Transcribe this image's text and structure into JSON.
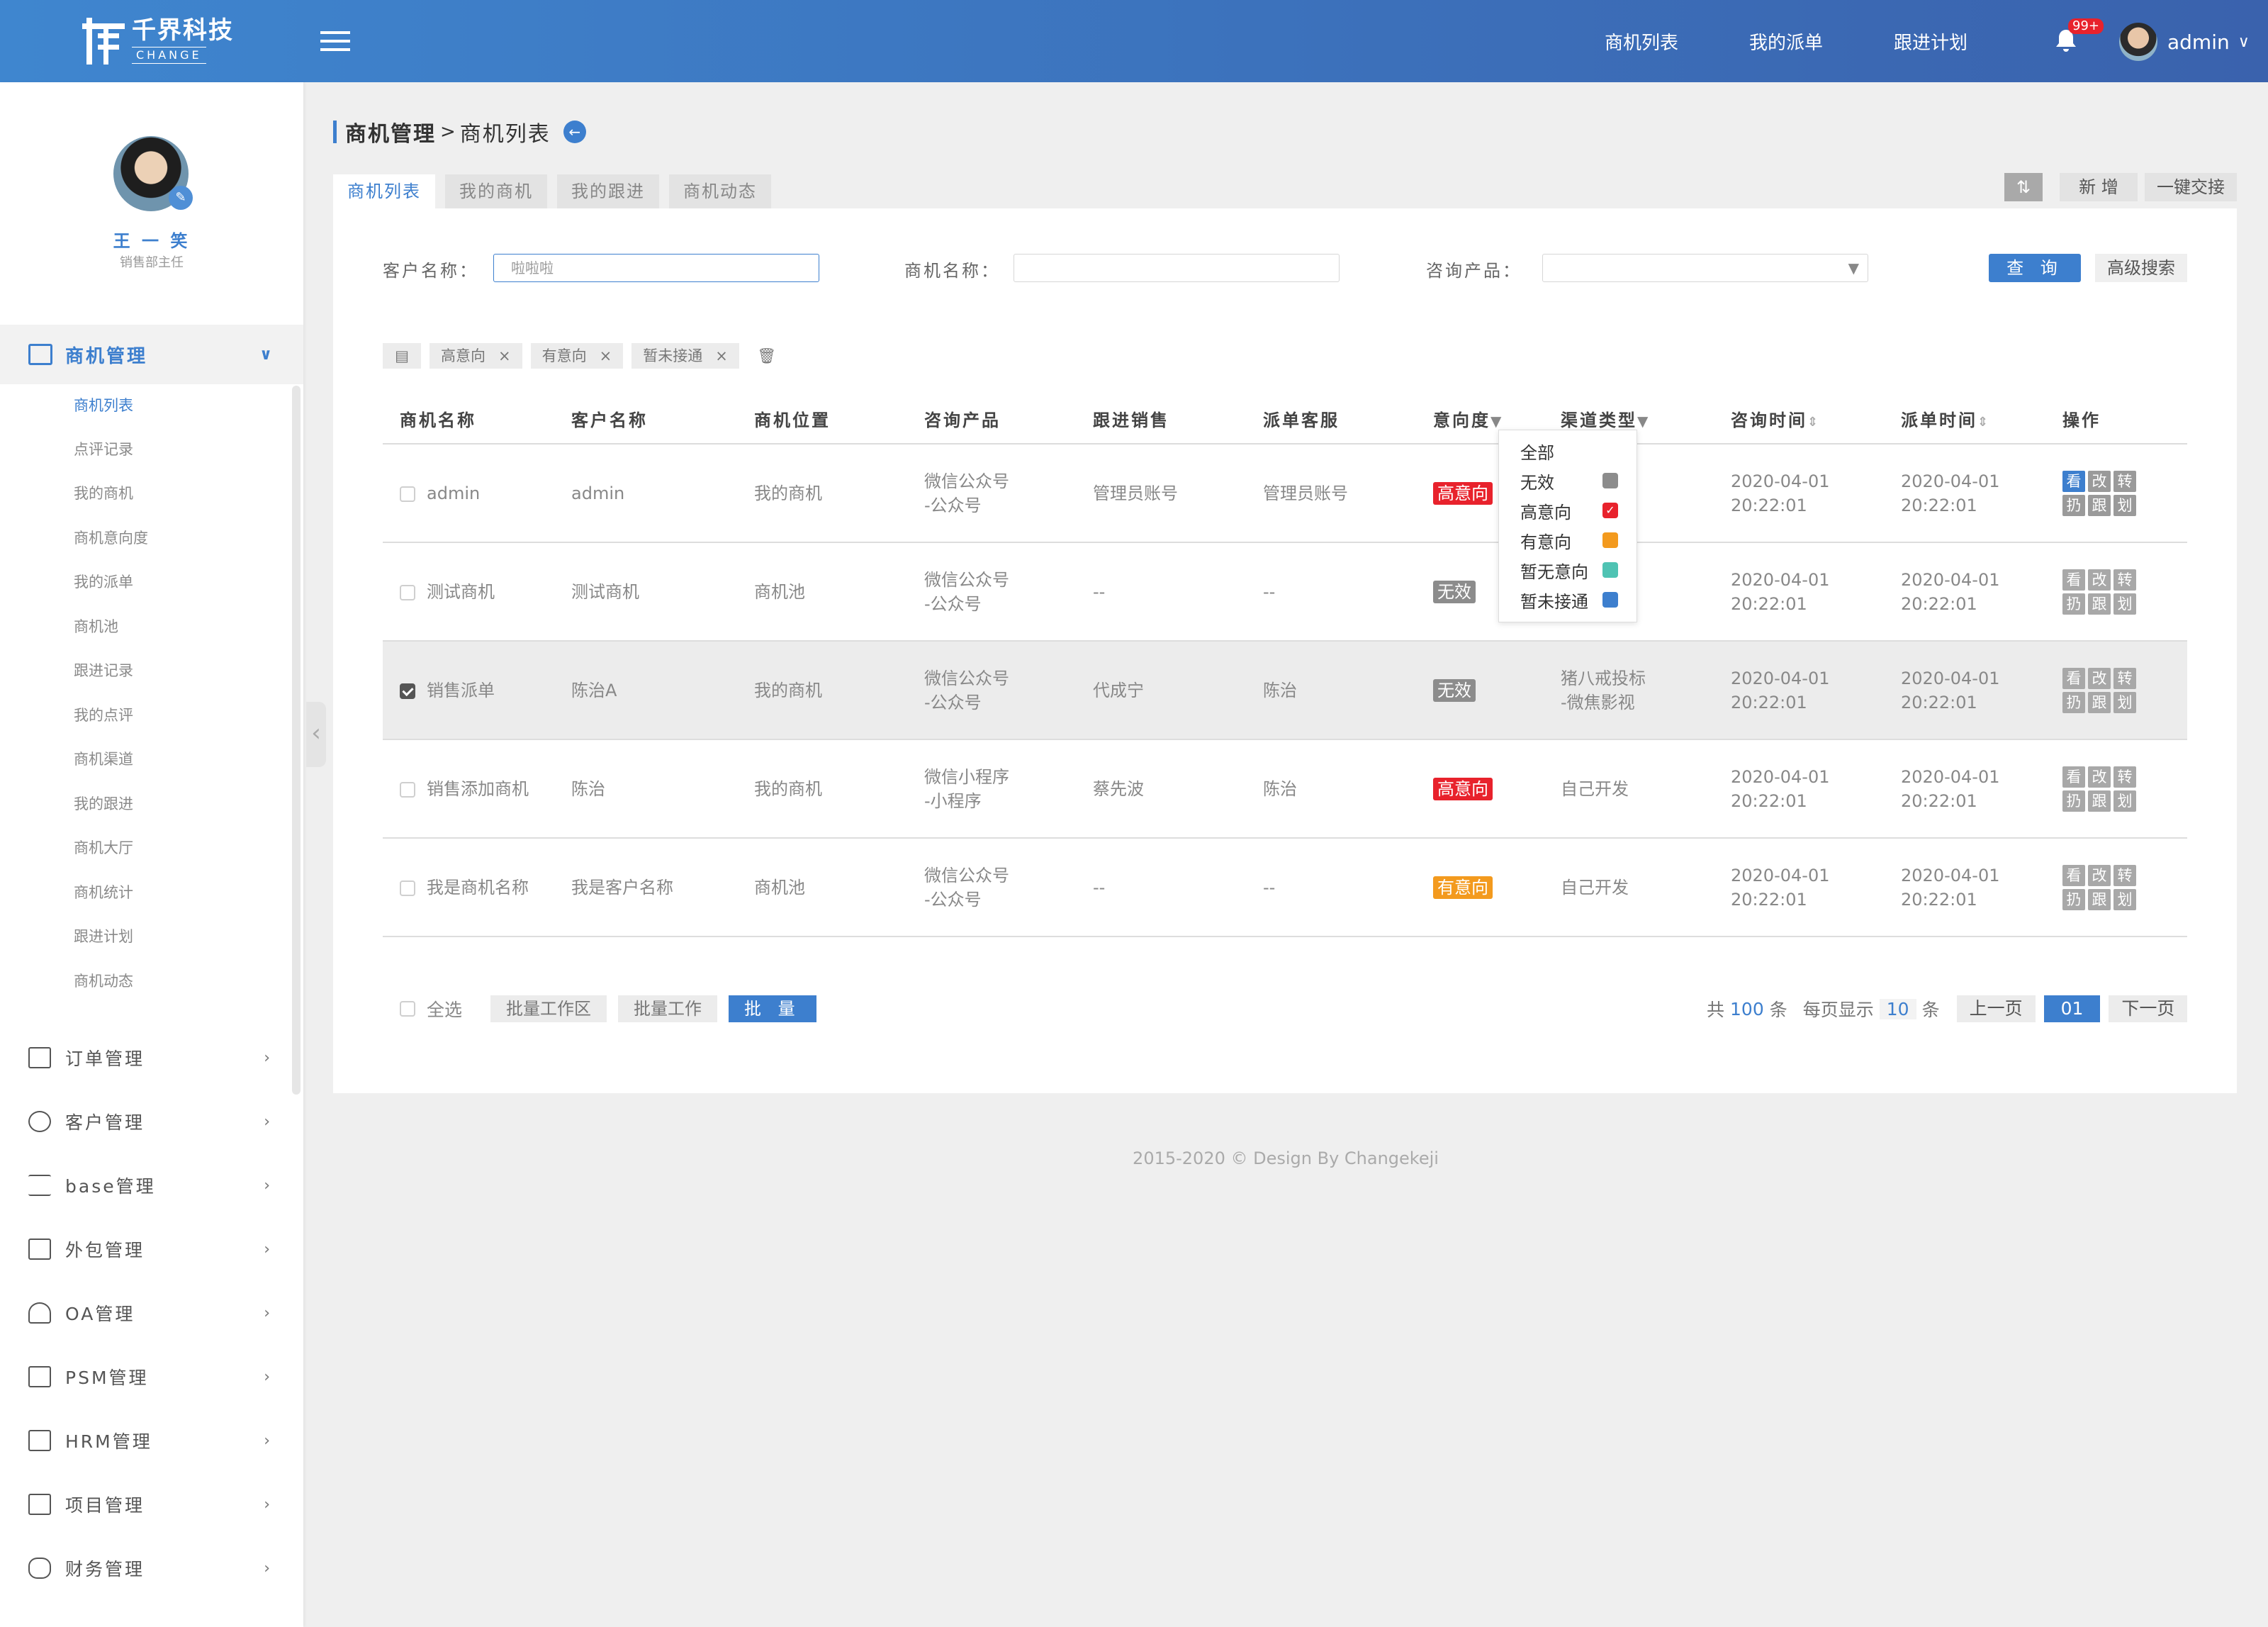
{
  "brand": {
    "name_cn": "千界科技",
    "name_en": "CHANGE"
  },
  "topnav": [
    "商机列表",
    "我的派单",
    "跟进计划"
  ],
  "notifications": {
    "count": "99+"
  },
  "user": {
    "name": "admin"
  },
  "profile": {
    "name": "王 一 笑",
    "role": "销售部主任"
  },
  "sidebar": {
    "active_section": "商机管理",
    "sub_items": [
      "商机列表",
      "点评记录",
      "我的商机",
      "商机意向度",
      "我的派单",
      "商机池",
      "跟进记录",
      "我的点评",
      "商机渠道",
      "我的跟进",
      "商机大厅",
      "商机统计",
      "跟进计划",
      "商机动态"
    ],
    "sections": [
      "订单管理",
      "客户管理",
      "base管理",
      "外包管理",
      "OA管理",
      "PSM管理",
      "HRM管理",
      "项目管理",
      "财务管理"
    ]
  },
  "breadcrumb": {
    "parent": "商机管理",
    "sep": ">",
    "current": "商机列表"
  },
  "tabs": [
    "商机列表",
    "我的商机",
    "我的跟进",
    "商机动态"
  ],
  "actions": {
    "new": "新 增",
    "handover": "一键交接"
  },
  "filters": {
    "customer_label": "客户名称：",
    "customer_value": "啦啦啦",
    "opportunity_label": "商机名称：",
    "product_label": "咨询产品：",
    "query": "查 询",
    "advanced": "高级搜索"
  },
  "chips": [
    "高意向",
    "有意向",
    "暂未接通"
  ],
  "table": {
    "headers": [
      "商机名称",
      "客户名称",
      "商机位置",
      "咨询产品",
      "跟进销售",
      "派单客服",
      "意向度",
      "渠道类型",
      "咨询时间",
      "派单时间",
      "操作"
    ],
    "rows": [
      {
        "name": "admin",
        "customer": "admin",
        "location": "我的商机",
        "product1": "微信公众号",
        "product2": "-公众号",
        "sales": "管理员账号",
        "service": "管理员账号",
        "intent": "高意向",
        "channel1": "",
        "channel2": "",
        "t1a": "2020-04-01",
        "t1b": "20:22:01",
        "t2a": "2020-04-01",
        "t2b": "20:22:01",
        "checked": false
      },
      {
        "name": "测试商机",
        "customer": "测试商机",
        "location": "商机池",
        "product1": "微信公众号",
        "product2": "-公众号",
        "sales": "--",
        "service": "--",
        "intent": "无效",
        "channel1": "",
        "channel2": "",
        "t1a": "2020-04-01",
        "t1b": "20:22:01",
        "t2a": "2020-04-01",
        "t2b": "20:22:01",
        "checked": false
      },
      {
        "name": "销售派单",
        "customer": "陈治A",
        "location": "我的商机",
        "product1": "微信公众号",
        "product2": "-公众号",
        "sales": "代成宁",
        "service": "陈治",
        "intent": "无效",
        "channel1": "猪八戒投标",
        "channel2": "-微焦影视",
        "t1a": "2020-04-01",
        "t1b": "20:22:01",
        "t2a": "2020-04-01",
        "t2b": "20:22:01",
        "checked": true
      },
      {
        "name": "销售添加商机",
        "customer": "陈治",
        "location": "我的商机",
        "product1": "微信小程序",
        "product2": "-小程序",
        "sales": "蔡先波",
        "service": "陈治",
        "intent": "高意向",
        "channel1": "自己开发",
        "channel2": "",
        "t1a": "2020-04-01",
        "t1b": "20:22:01",
        "t2a": "2020-04-01",
        "t2b": "20:22:01",
        "checked": false
      },
      {
        "name": "我是商机名称",
        "customer": "我是客户名称",
        "location": "商机池",
        "product1": "微信公众号",
        "product2": "-公众号",
        "sales": "--",
        "service": "--",
        "intent": "有意向",
        "channel1": "自己开发",
        "channel2": "",
        "t1a": "2020-04-01",
        "t1b": "20:22:01",
        "t2a": "2020-04-01",
        "t2b": "20:22:01",
        "checked": false
      }
    ],
    "ops": [
      "看",
      "改",
      "转",
      "扔",
      "跟",
      "划"
    ]
  },
  "intent_dropdown": [
    "全部",
    "无效",
    "高意向",
    "有意向",
    "暂无意向",
    "暂未接通"
  ],
  "colors": {
    "无效": "#8c8c8c",
    "高意向": "#e8222c",
    "有意向": "#f39a1e",
    "暂无意向": "#4fc3b3",
    "暂未接通": "#3d7fce",
    "accent": "#3d7fce"
  },
  "bottom": {
    "select_all": "全选",
    "batch_area": "批量工作区",
    "batch_work": "批量工作",
    "batch": "批 量"
  },
  "pagination": {
    "total_prefix": "共",
    "total": "100",
    "total_suffix": "条",
    "per_page_prefix": "每页显示",
    "per_page": "10",
    "per_page_suffix": "条",
    "prev": "上一页",
    "current": "01",
    "next": "下一页"
  },
  "footer": "2015-2020 © Design By Changekeji"
}
